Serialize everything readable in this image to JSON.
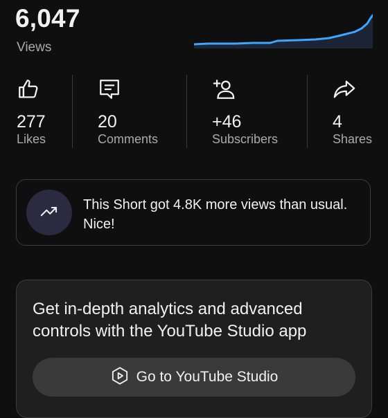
{
  "views": {
    "value": "6,047",
    "label": "Views"
  },
  "sparkline": {
    "color": "#3ea6ff",
    "fill": "#1c2535"
  },
  "stats": [
    {
      "value": "277",
      "label": "Likes",
      "icon": "thumbs-up-icon"
    },
    {
      "value": "20",
      "label": "Comments",
      "icon": "comment-icon"
    },
    {
      "value": "+46",
      "label": "Subscribers",
      "icon": "add-person-icon"
    },
    {
      "value": "4",
      "label": "Shares",
      "icon": "share-icon"
    }
  ],
  "insight": {
    "text": "This Short got 4.8K more views than usual. Nice!",
    "icon": "trending-up-icon"
  },
  "studio": {
    "title": "Get in-depth analytics and advanced controls with the YouTube Studio app",
    "button_label": "Go to YouTube Studio",
    "button_icon": "youtube-studio-icon"
  }
}
